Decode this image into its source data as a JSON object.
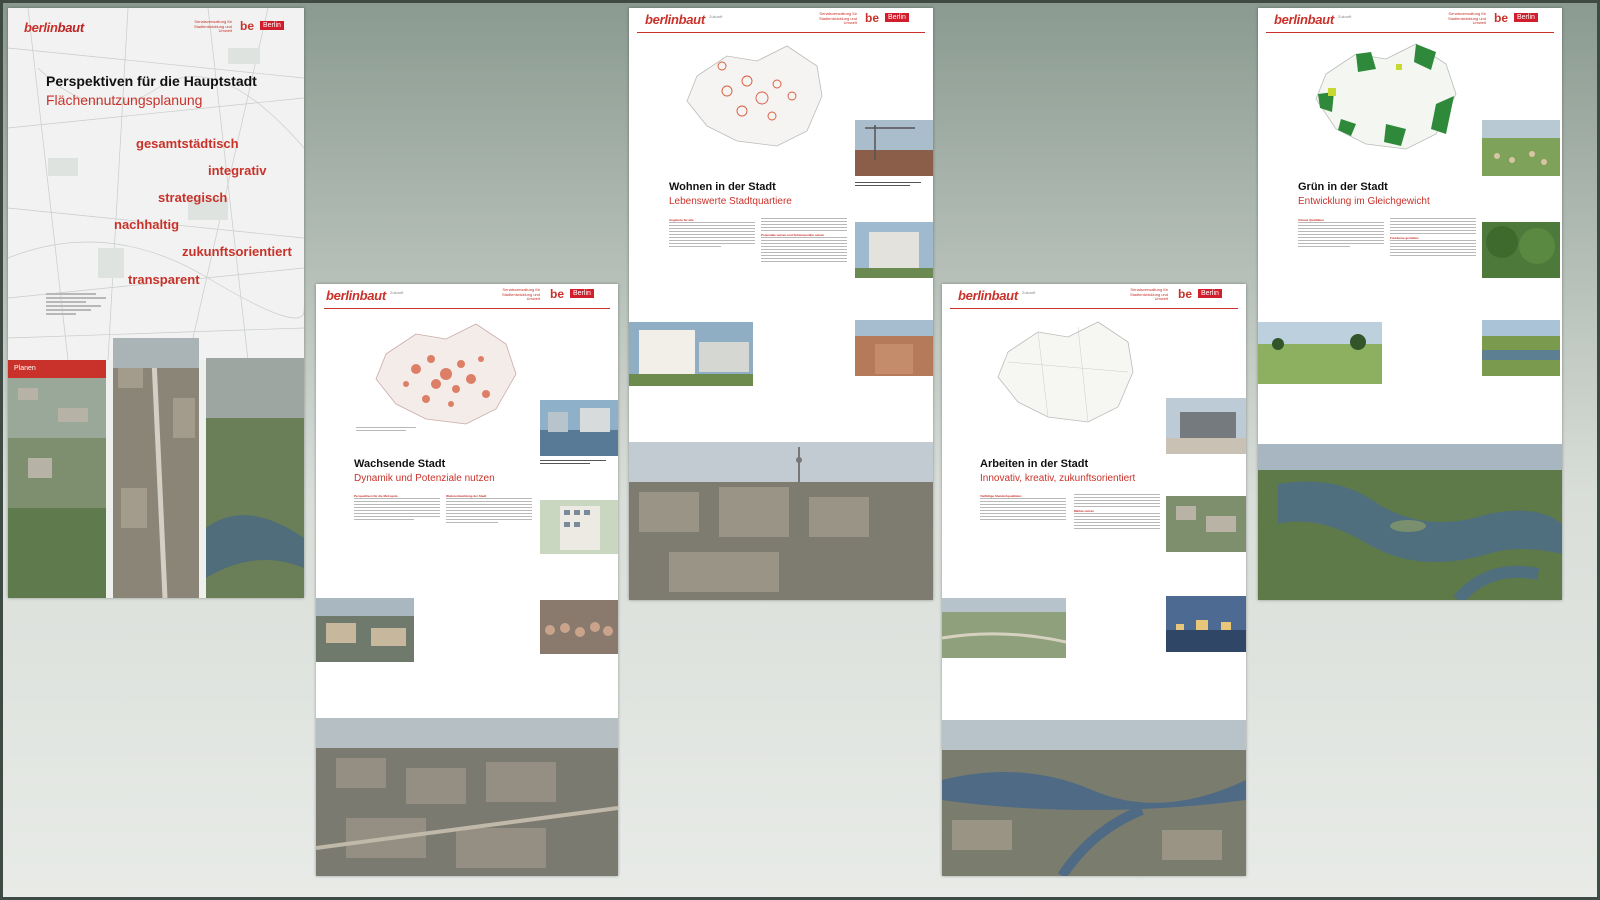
{
  "brand": {
    "name_a": "berlin",
    "name_b": "baut",
    "zukunft": "Zukunft",
    "senat": "Senatsverwaltung für Stadtentwicklung und Umwelt",
    "be": "be",
    "berlin": "Berlin"
  },
  "cover": {
    "title": "Perspektiven für die Hauptstadt",
    "subtitle": "Flächennutzungsplanung",
    "keywords": [
      "gesamtstädtisch",
      "integrativ",
      "strategisch",
      "nachhaltig",
      "zukunftsorientiert",
      "transparent"
    ],
    "tab": "Planen"
  },
  "posters": [
    {
      "id": "wachsende",
      "title": "Wachsende Stadt",
      "subtitle": "Dynamik und Potenziale nutzen",
      "h1": "Perspektiven für die Metropole",
      "h2": "Weiterentwicklung der Stadt"
    },
    {
      "id": "wohnen",
      "title": "Wohnen in der Stadt",
      "subtitle": "Lebenswerte Stadtquartiere",
      "h1": "Angebote für alle",
      "h2": "Potenziale nutzen und Schwerpunkte setzen"
    },
    {
      "id": "arbeiten",
      "title": "Arbeiten in der Stadt",
      "subtitle": "Innovativ, kreativ, zukunftsorientiert",
      "h1": "Vielfältige Standortqualitäten",
      "h2": "Märkte nutzen"
    },
    {
      "id": "gruen",
      "title": "Grün in der Stadt",
      "subtitle": "Entwicklung im Gleichgewicht",
      "h1": "Urbane Qualitäten",
      "h2": "Freiräume gestalten"
    }
  ],
  "colors": {
    "accent": "#c9322a",
    "map_red": "#d65a3c",
    "map_green": "#2e8a3a"
  }
}
